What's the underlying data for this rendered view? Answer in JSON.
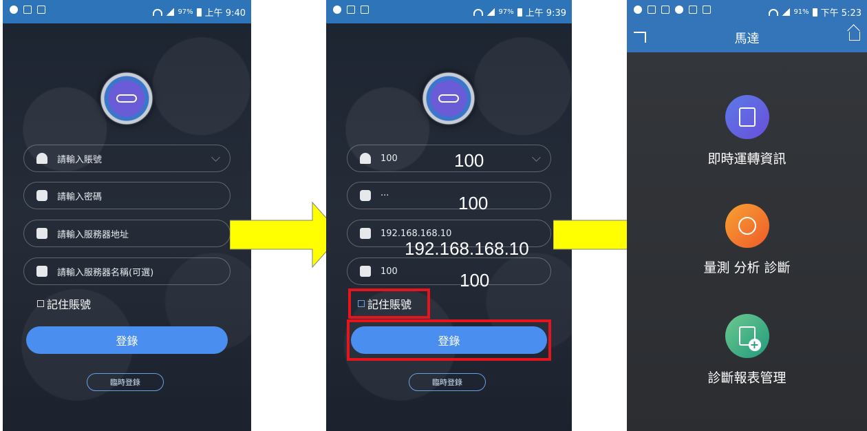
{
  "phone1": {
    "status": {
      "battery": "97%",
      "time": "上午 9:40"
    },
    "fields": [
      {
        "icon": "user-icon",
        "placeholder": "請輸入賬號"
      },
      {
        "icon": "lock-icon",
        "placeholder": "請輸入密碼"
      },
      {
        "icon": "server-address-icon",
        "placeholder": "請輸入服務器地址"
      },
      {
        "icon": "server-name-icon",
        "placeholder": "請輸入服務器名稱(可選)"
      }
    ],
    "remember": "記住賬號",
    "login": "登錄",
    "temp_login": "臨時登錄"
  },
  "phone2": {
    "status": {
      "battery": "97%",
      "time": "上午 9:39"
    },
    "fields": [
      {
        "icon": "user-icon",
        "value": "100"
      },
      {
        "icon": "lock-icon",
        "value": "···"
      },
      {
        "icon": "server-address-icon",
        "value": "192.168.168.10"
      },
      {
        "icon": "server-name-icon",
        "value": "100"
      }
    ],
    "overlays": [
      "100",
      "100",
      "192.168.168.10",
      "100"
    ],
    "remember": "記住賬號",
    "login": "登錄",
    "temp_login": "臨時登錄"
  },
  "phone3": {
    "status": {
      "battery": "91%",
      "time": "下午 5:23"
    },
    "title": "馬達",
    "menu": [
      {
        "label": "即時運轉資訊",
        "icon": "report-settings-icon",
        "color": "#5b5ee0"
      },
      {
        "label": "量測 分析 診斷",
        "icon": "stethoscope-icon",
        "color": "#f06a2c"
      },
      {
        "label": "診斷報表管理",
        "icon": "clipboard-plus-icon",
        "color": "#2fa37c"
      }
    ]
  }
}
